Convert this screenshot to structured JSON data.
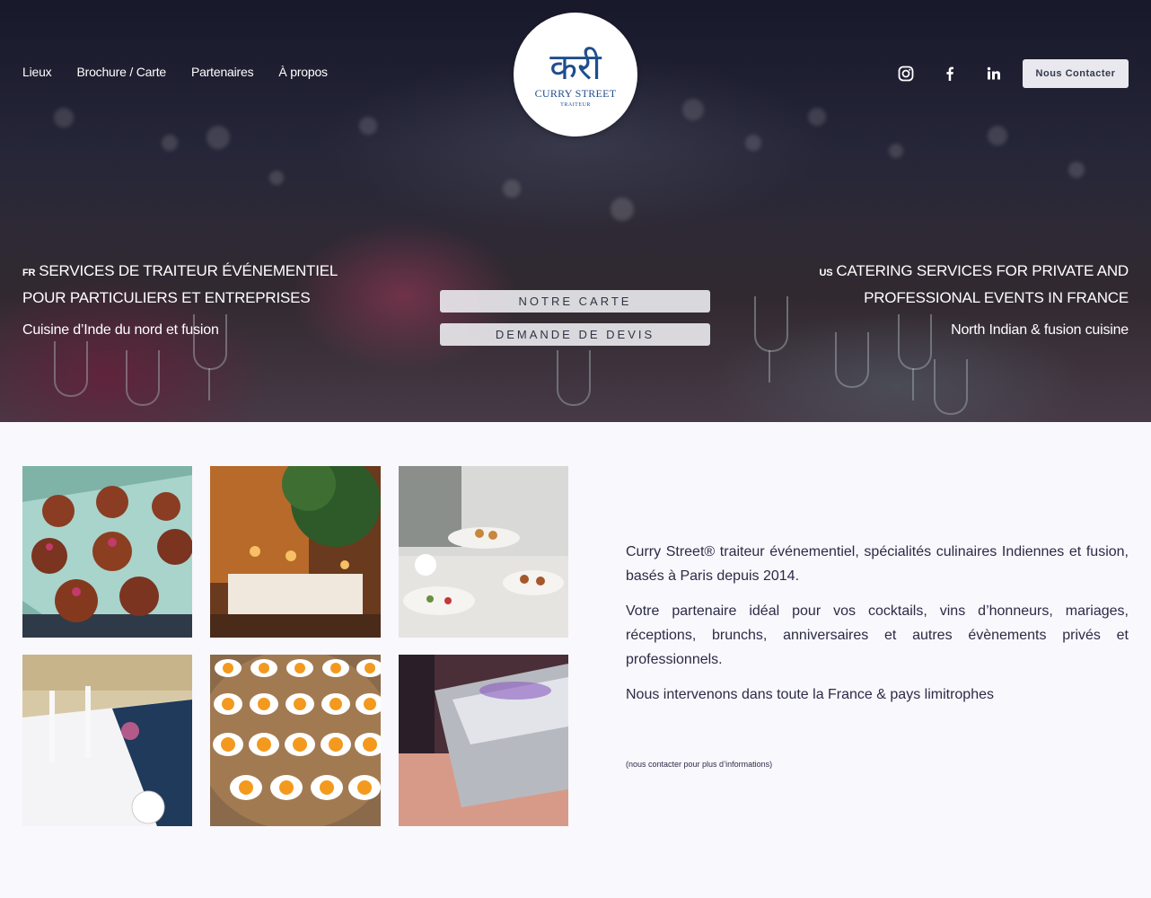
{
  "nav": {
    "items": [
      "Lieux",
      "Brochure / Carte",
      "Partenaires",
      "À propos"
    ]
  },
  "logo": {
    "script_text": "करी",
    "brand": "CURRY STREET",
    "subtitle": "TRAITEUR"
  },
  "social": {
    "icons": [
      "instagram-icon",
      "facebook-icon",
      "linkedin-icon"
    ]
  },
  "header": {
    "contact_label": "Nous Contacter"
  },
  "hero": {
    "fr": {
      "code": "FR",
      "line1": "SERVICES DE TRAITEUR ÉVÉNEMENTIEL",
      "line2": "POUR PARTICULIERS ET ENTREPRISES",
      "tagline": "Cuisine d’Inde du nord et fusion"
    },
    "us": {
      "code": "US",
      "line1": "CATERING SERVICES FOR PRIVATE AND",
      "line2": "PROFESSIONAL EVENTS IN FRANCE",
      "tagline": "North Indian & fusion cuisine"
    },
    "buttons": {
      "menu": "NOTRE CARTE",
      "quote": "DEMANDE DE DEVIS"
    }
  },
  "gallery": {
    "photos": [
      "photo-canapes",
      "photo-garden-dinner",
      "photo-buffet",
      "photo-banquet-hall",
      "photo-appetizer-spoons",
      "photo-chafing-dish"
    ]
  },
  "intro": {
    "p1": "Curry Street® traiteur événementiel, spécialités culinaires Indiennes et fusion, basés à Paris depuis 2014.",
    "p2": "Votre partenaire idéal pour vos cocktails, vins d’honneurs, mariages, réceptions, brunchs, anniversaires et autres évènements privés et professionnels.",
    "p3": "Nous intervenons dans toute la France & pays limitrophes",
    "note": "(nous contacter pour plus d’informations)"
  },
  "colors": {
    "brand_blue": "#1f4e8c",
    "text_dark": "#2c2b47",
    "page_bg": "#f9f8fc"
  }
}
